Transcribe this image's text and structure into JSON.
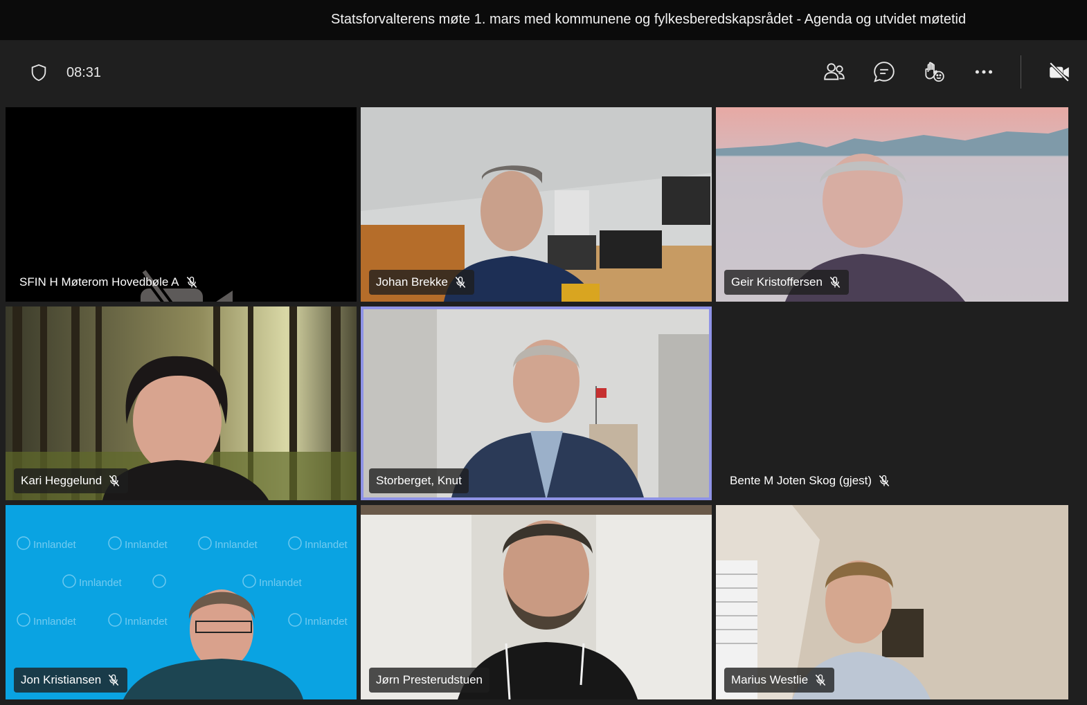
{
  "meeting": {
    "title": "Statsforvalterens møte 1. mars med kommunene og fylkesberedskapsrådet - Agenda og utvidet møtetid",
    "timer": "08:31"
  },
  "toolbar": {
    "icons": [
      "shield-icon",
      "people-icon",
      "chat-icon",
      "raise-hand-icon",
      "more-icon",
      "camera-off-icon"
    ]
  },
  "participants": [
    {
      "name": "SFIN H Møterom Hovedbøle A",
      "muted": true,
      "video": false
    },
    {
      "name": "Johan Brekke",
      "muted": true,
      "video": true
    },
    {
      "name": "Geir Kristoffersen",
      "muted": true,
      "video": true
    },
    {
      "name": "Kari Heggelund",
      "muted": true,
      "video": true
    },
    {
      "name": "Storberget, Knut",
      "muted": false,
      "video": true,
      "speaking": true
    },
    {
      "name": "Bente M Joten Skog (gjest)",
      "muted": true,
      "video": false
    },
    {
      "name": "Jon Kristiansen",
      "muted": true,
      "video": true
    },
    {
      "name": "Jørn Presterudstuen",
      "muted": false,
      "video": true
    },
    {
      "name": "Marius Westlie",
      "muted": true,
      "video": true
    }
  ],
  "backgrounds": {
    "nho_logo_text": "Innlandet"
  },
  "colors": {
    "active_speaker_ring": "#8f93e6",
    "title_bar": "#0b0b0b",
    "app_bg": "#1f1f1f"
  }
}
